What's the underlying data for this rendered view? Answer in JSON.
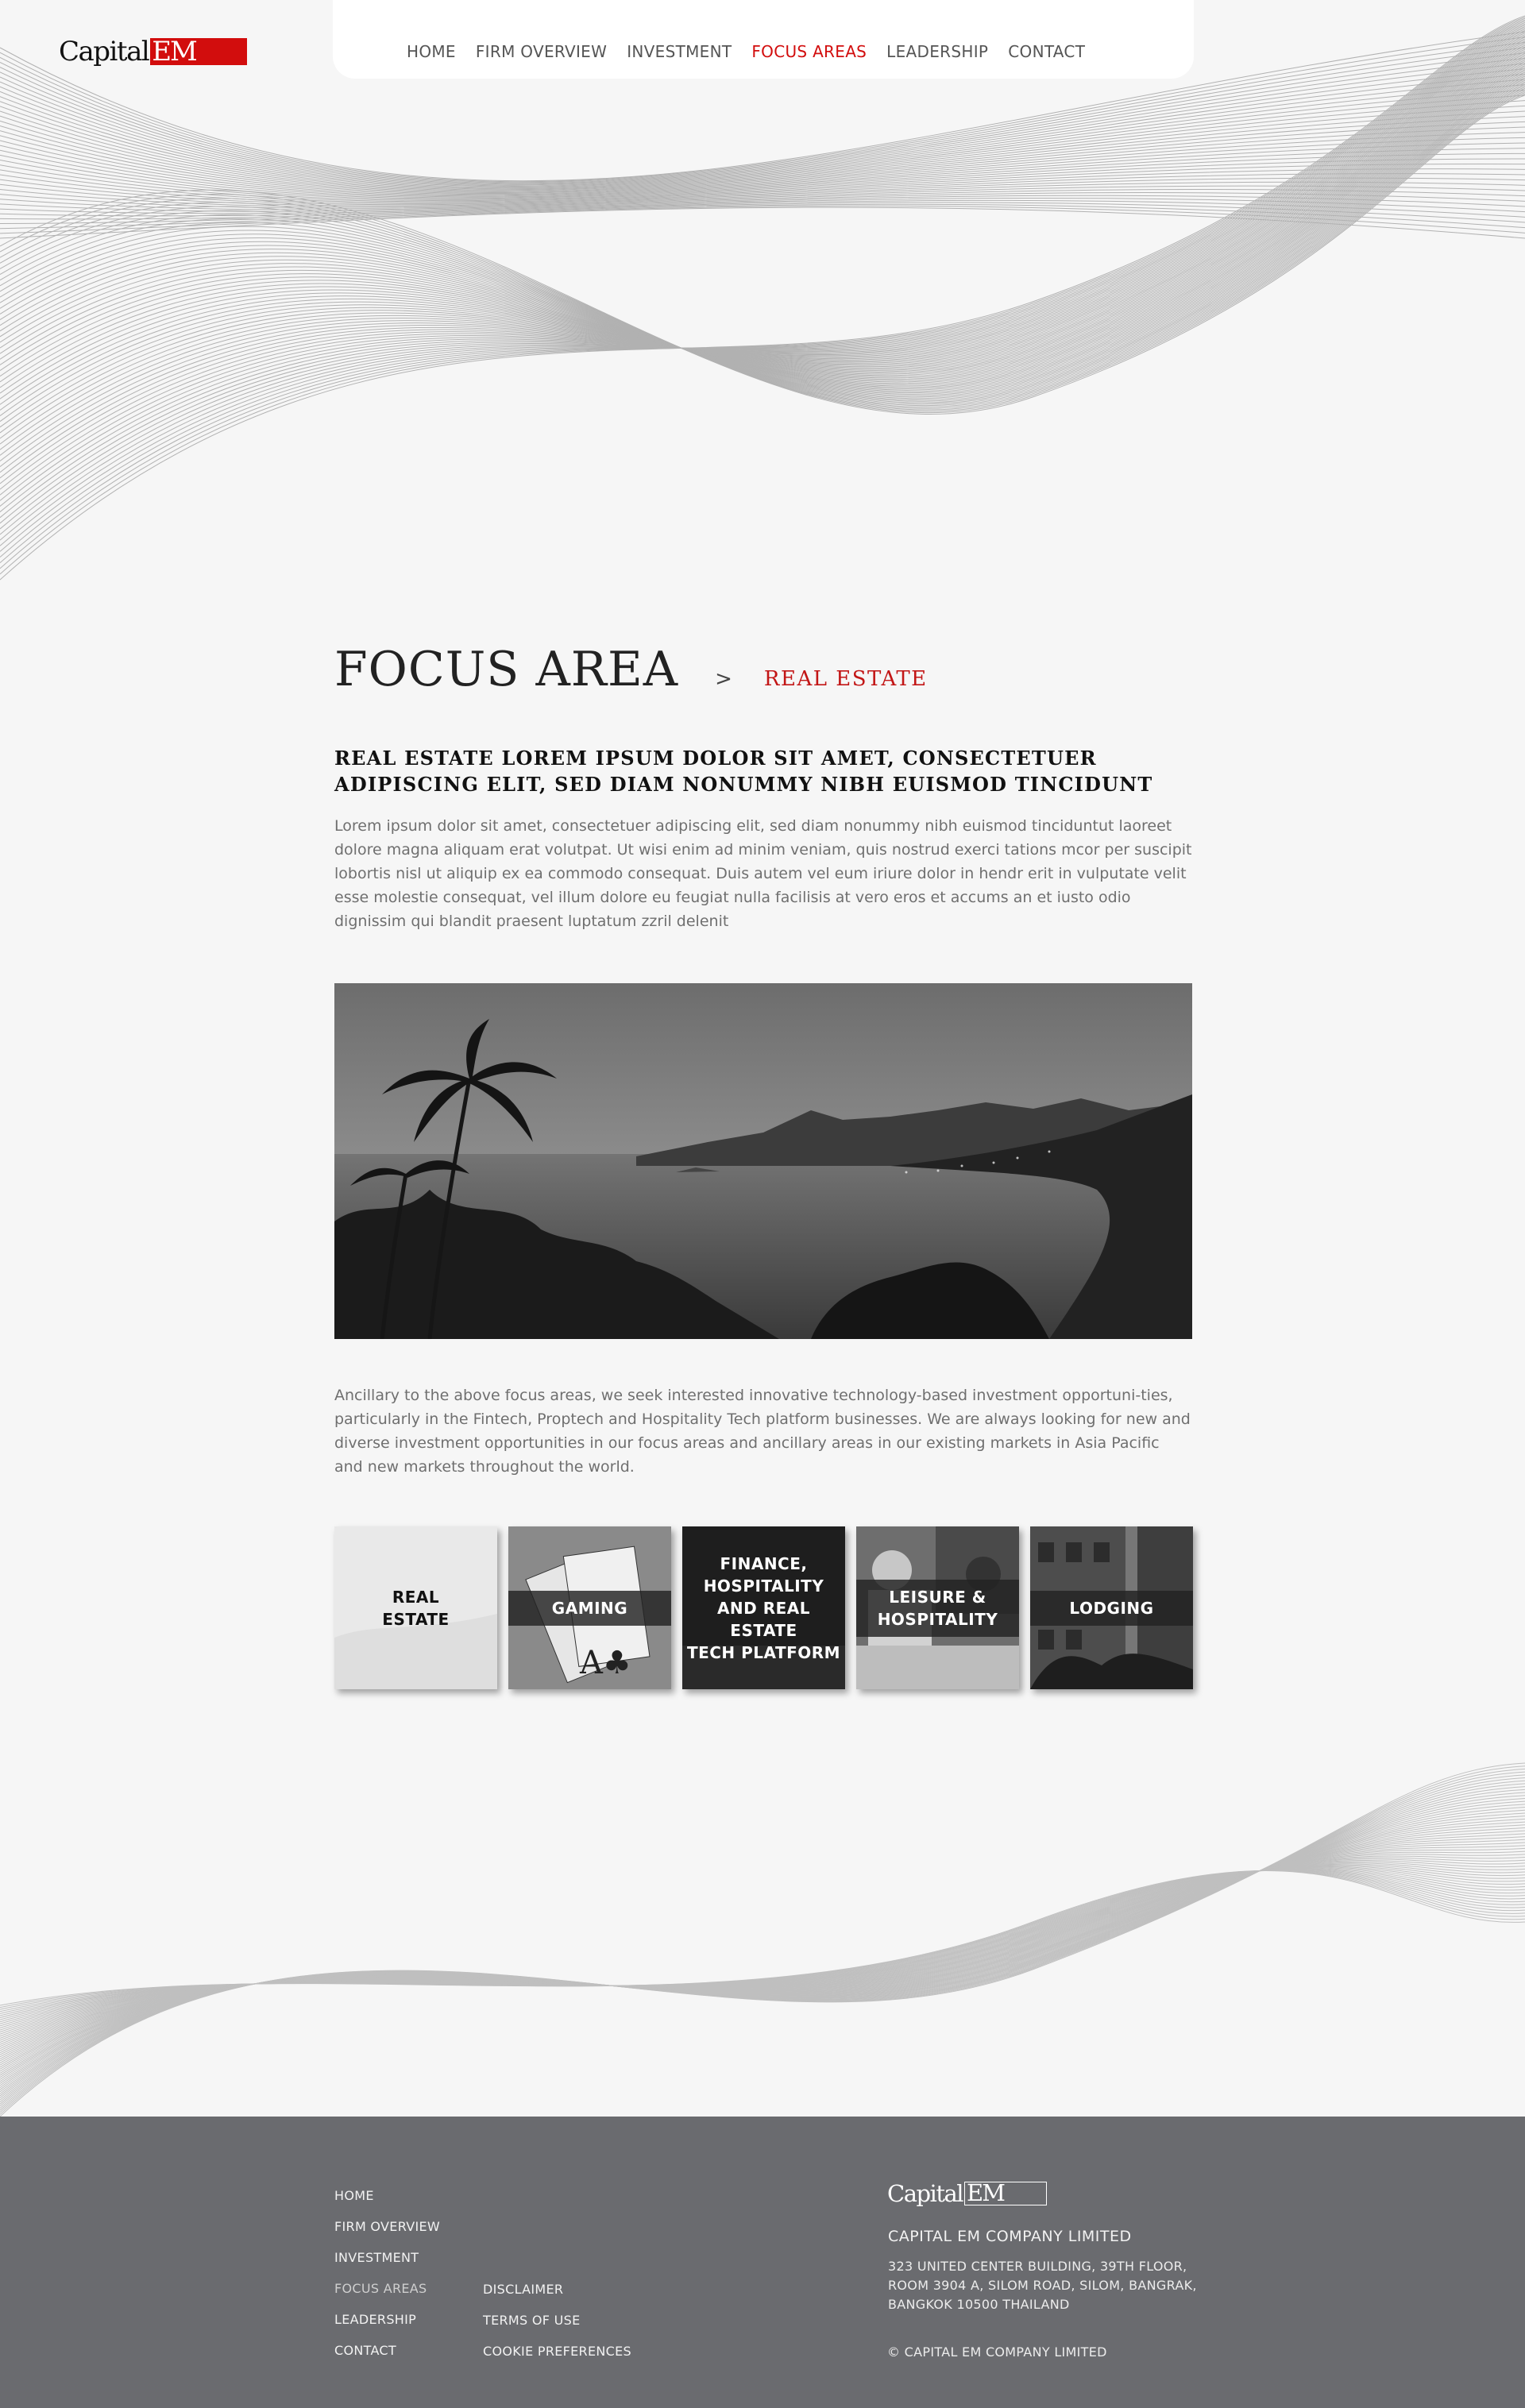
{
  "header": {
    "logo_word": "Capital",
    "logo_mark": "EM",
    "nav": [
      {
        "label": "HOME"
      },
      {
        "label": "FIRM OVERVIEW"
      },
      {
        "label": "INVESTMENT"
      },
      {
        "label": "FOCUS AREAS",
        "active": true
      },
      {
        "label": "LEADERSHIP"
      },
      {
        "label": "CONTACT"
      }
    ],
    "accent_color": "#d20d0d"
  },
  "main": {
    "title": "FOCUS AREA",
    "chevron": ">",
    "breadcrumb_current": "REAL ESTATE",
    "headline": "REAL ESTATE LOREM IPSUM DOLOR SIT AMET, CONSECTETUER ADIPISCING ELIT, SED DIAM NONUMMY NIBH EUISMOD TINCIDUNT",
    "paragraph1": "Lorem ipsum dolor sit amet, consectetuer adipiscing elit, sed diam nonummy nibh euismod tinciduntut laoreet dolore magna aliquam erat volutpat. Ut wisi enim ad minim veniam, quis nostrud exerci tations mcor per suscipit lobortis nisl ut aliquip ex ea commodo consequat. Duis autem vel eum iriure dolor in hendr erit in vulputate velit esse molestie consequat, vel illum dolore eu feugiat nulla facilisis at vero eros et accums an et iusto odio dignissim qui blandit praesent luptatum zzril delenit",
    "paragraph2": "Ancillary to the above focus areas, we seek interested innovative technology-based investment opportuni-ties, particularly in the Fintech, Proptech and Hospitality Tech platform businesses. We are always looking for new and diverse investment opportunities in our focus areas and ancillary areas in our existing markets in Asia Pacific and new markets throughout the world.",
    "tiles": [
      {
        "label": "REAL\nESTATE"
      },
      {
        "label": "GAMING"
      },
      {
        "label": "FINANCE,\nHOSPITALITY\nAND REAL ESTATE\nTECH PLATFORM"
      },
      {
        "label": "LEISURE  &\nHOSPITALITY"
      },
      {
        "label": "LODGING"
      }
    ]
  },
  "footer": {
    "col1": [
      "HOME",
      "FIRM OVERVIEW",
      "INVESTMENT",
      "FOCUS AREAS",
      "LEADERSHIP",
      "CONTACT"
    ],
    "col2": [
      "DISCLAIMER",
      "TERMS OF USE",
      "COOKIE PREFERENCES"
    ],
    "logo_word": "Capital",
    "logo_mark": "EM",
    "company": "CAPITAL EM COMPANY LIMITED",
    "address_lines": [
      "323 UNITED CENTER BUILDING, 39TH FLOOR,",
      "ROOM 3904 A, SILOM ROAD, SILOM, BANGRAK,",
      "BANGKOK 10500 THAILAND"
    ],
    "copyright": "© CAPITAL EM COMPANY LIMITED",
    "bg_color": "#6a6b6f"
  }
}
